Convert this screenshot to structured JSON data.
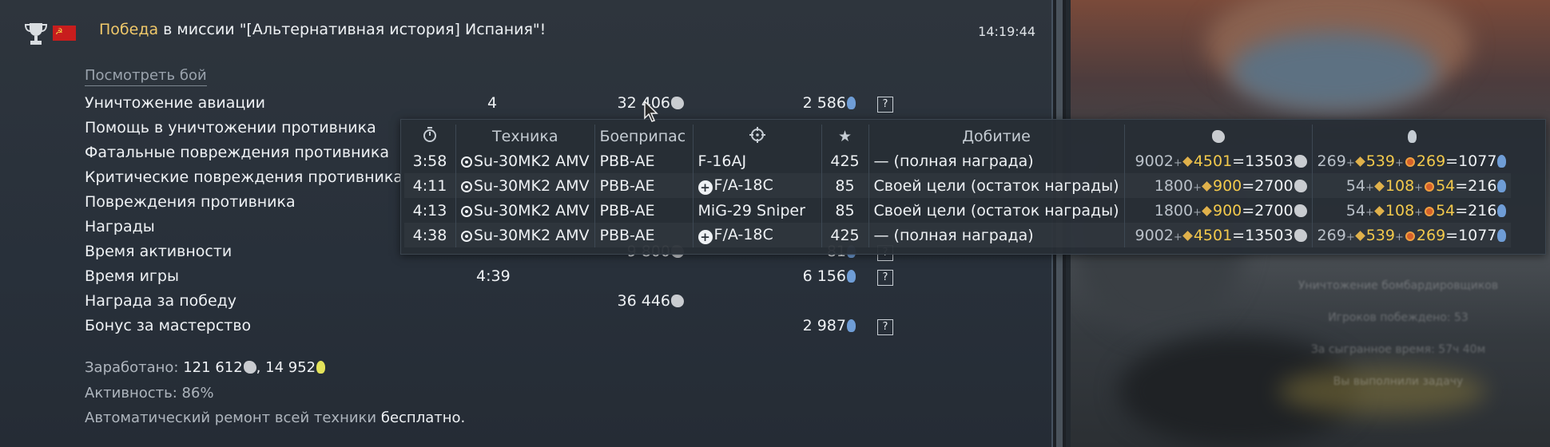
{
  "header": {
    "title_highlight": "Победа",
    "title_rest": " в миссии \"[Альтернативная история] Испания\"!",
    "time": "14:19:44"
  },
  "view_battle": "Посмотреть бой",
  "stats": [
    {
      "label": "Уничтожение авиации",
      "count": "4",
      "lions": "32 406",
      "rp": "2 586"
    },
    {
      "label": "Помощь в уничтожении противника",
      "count": "",
      "lions": "",
      "rp": ""
    },
    {
      "label": "Фатальные повреждения противника",
      "count": "",
      "lions": "",
      "rp": ""
    },
    {
      "label": "Критические повреждения противника",
      "count": "",
      "lions": "",
      "rp": ""
    },
    {
      "label": "Повреждения противника",
      "count": "",
      "lions": "",
      "rp": ""
    },
    {
      "label": "Награды",
      "count": "",
      "lions": "",
      "rp": ""
    },
    {
      "label": "Время активности",
      "count": "",
      "lions": "9 800",
      "rp": "81"
    },
    {
      "label": "Время игры",
      "count": "4:39",
      "lions": "",
      "rp": "6 156"
    },
    {
      "label": "Награда за победу",
      "count": "",
      "lions": "36 446",
      "rp": ""
    },
    {
      "label": "Бонус за мастерство",
      "count": "",
      "lions": "",
      "rp": "2 987"
    }
  ],
  "help_label": "?",
  "summary": {
    "earned_label": "Заработано: ",
    "earned_lions": "121 612",
    "earned_sep": ", ",
    "earned_rp": "14 952",
    "activity_label": "Активность: ",
    "activity_value": "86%",
    "repair_label": "Автоматический ремонт всей техники ",
    "repair_value": "бесплатно."
  },
  "tooltip": {
    "headers": {
      "vehicle": "Техника",
      "ammo": "Боеприпас",
      "finish": "Добитие"
    },
    "rows": [
      {
        "time": "3:58",
        "vehicle": "Su-30MK2 AMV",
        "ammo": "PBB-AE",
        "target": "F-16AJ",
        "target_icon": "",
        "stars": "425",
        "finish": "— (полная награда)",
        "l_base": "9002",
        "l_bonus": "4501",
        "l_total": "=13503",
        "r_base": "269",
        "r_bonus1": "539",
        "r_bonus2": "269",
        "r_total": "=1077"
      },
      {
        "time": "4:11",
        "vehicle": "Su-30MK2 AMV",
        "ammo": "PBB-AE",
        "target": "F/A-18C",
        "target_icon": "cross",
        "stars": "85",
        "finish": "Своей цели (остаток награды)",
        "l_base": "1800",
        "l_bonus": "900",
        "l_total": "=2700",
        "r_base": "54",
        "r_bonus1": "108",
        "r_bonus2": "54",
        "r_total": "=216"
      },
      {
        "time": "4:13",
        "vehicle": "Su-30MK2 AMV",
        "ammo": "PBB-AE",
        "target": "MiG-29 Sniper",
        "target_icon": "",
        "stars": "85",
        "finish": "Своей цели (остаток награды)",
        "l_base": "1800",
        "l_bonus": "900",
        "l_total": "=2700",
        "r_base": "54",
        "r_bonus1": "108",
        "r_bonus2": "54",
        "r_total": "=216"
      },
      {
        "time": "4:38",
        "vehicle": "Su-30MK2 AMV",
        "ammo": "PBB-AE",
        "target": "F/A-18C",
        "target_icon": "cross",
        "stars": "425",
        "finish": "— (полная награда)",
        "l_base": "9002",
        "l_bonus": "4501",
        "l_total": "=13503",
        "r_base": "269",
        "r_bonus1": "539",
        "r_bonus2": "269",
        "r_total": "=1077"
      }
    ]
  },
  "background_text": [
    "Уничтожение бомбардировщиков",
    "Игроков побеждено: 53",
    "За сыгранное время: 57ч 40м",
    "Вы выполнили задачу"
  ],
  "colors": {
    "accent_gold": "#f0c86a",
    "panel": "#2a3139",
    "rp_blue": "#6f9dd6"
  }
}
